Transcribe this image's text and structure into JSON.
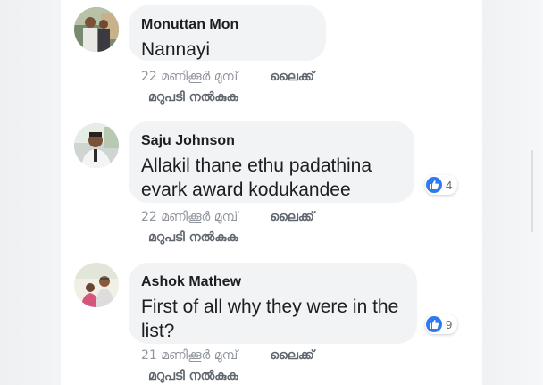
{
  "comments": [
    {
      "author": "Monuttan Mon",
      "text": "Nannayi",
      "time": "22 മണിക്കൂർ മുമ്പ്",
      "like_label": "ലൈക്ക്",
      "reply_label": "മറുപടി നൽകുക",
      "reaction_count": null,
      "avatar_icon": "profile-photo"
    },
    {
      "author": "Saju Johnson",
      "text": "Allakil thane ethu padathina evark award  kodukandee",
      "text_line1": "Allakil thane ethu padathina",
      "text_line2": "evark award  kodukandee",
      "time": "22 മണിക്കൂർ മുമ്പ്",
      "like_label": "ലൈക്ക്",
      "reply_label": "മറുപടി നൽകുക",
      "reaction_count": "4",
      "avatar_icon": "profile-photo"
    },
    {
      "author": "Ashok Mathew",
      "text": "First of all why they were in the list?",
      "text_line1": "First of all why they were in the",
      "text_line2": "list?",
      "time": "21 മണിക്കൂർ മുമ്പ്",
      "like_label": "ലൈക്ക്",
      "reply_label": "മറുപടി നൽകുക",
      "reaction_count": "9",
      "avatar_icon": "profile-photo"
    }
  ],
  "colors": {
    "bubble": "#f2f3f5",
    "author_text": "#1c1e21",
    "meta_text": "#90949c",
    "action_text": "#606770",
    "like_blue": "#2e7bf0"
  },
  "icons": {
    "reaction": "thumbs-up-icon"
  }
}
